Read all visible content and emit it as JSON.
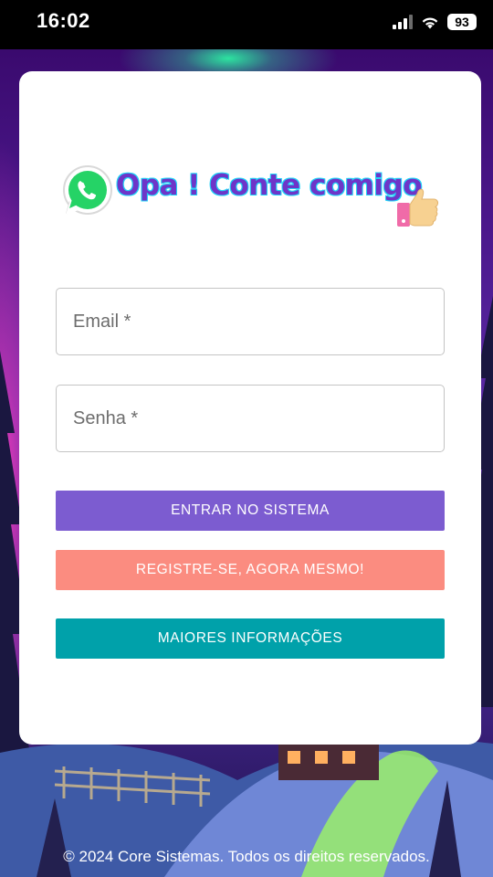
{
  "status_bar": {
    "time": "16:02",
    "battery": "93",
    "icons": [
      "signal-icon",
      "wifi-icon",
      "battery-icon"
    ]
  },
  "brand": {
    "title": "Opa ! Conte comigo",
    "icons": [
      "whatsapp-icon",
      "thumbs-up-icon"
    ]
  },
  "form": {
    "email_placeholder": "Email *",
    "email_value": "",
    "password_placeholder": "Senha *",
    "password_value": ""
  },
  "buttons": {
    "login": "ENTRAR NO SISTEMA",
    "register": "REGISTRE-SE, AGORA MESMO!",
    "info": "MAIORES INFORMAÇÕES"
  },
  "footer": {
    "text": "© 2024 Core Sistemas. Todos os direitos reservados."
  },
  "colors": {
    "login_button": "#7c5cd0",
    "register_button": "#fb8c80",
    "info_button": "#00a1aa",
    "background_purple": "#4a178a",
    "aurora_green": "#2de3a0",
    "aurora_pink": "#ff3dbd"
  }
}
